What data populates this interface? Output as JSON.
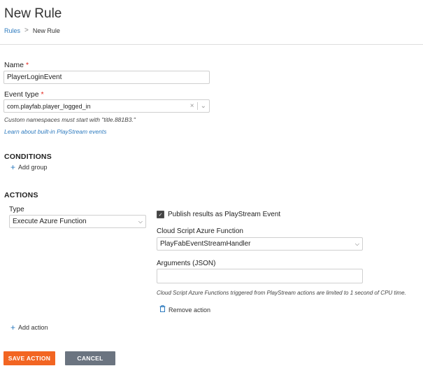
{
  "header": {
    "title": "New Rule",
    "breadcrumb": {
      "parent": "Rules",
      "separator": ">",
      "current": "New Rule"
    }
  },
  "form": {
    "name_label": "Name",
    "name_value": "PlayerLoginEvent",
    "required_mark": "*",
    "event_type_label": "Event type",
    "event_type_value": "com.playfab.player_logged_in",
    "clear_glyph": "×",
    "chevron_glyph": "⌄",
    "namespace_hint": "Custom namespaces must start with \"title.881B3.\"",
    "learn_link": "Learn about built-in PlayStream events"
  },
  "conditions": {
    "heading": "CONDITIONS",
    "add_group": "Add group"
  },
  "actions": {
    "heading": "ACTIONS",
    "type_label": "Type",
    "type_value": "Execute Azure Function",
    "publish_label": "Publish results as PlayStream Event",
    "publish_checked": true,
    "cs_function_label": "Cloud Script Azure Function",
    "cs_function_value": "PlayFabEventStreamHandler",
    "args_label": "Arguments (JSON)",
    "args_value": "",
    "cpu_note": "Cloud Script Azure Functions triggered from PlayStream actions are limited to 1 second of CPU time.",
    "remove_action": "Remove action",
    "add_action": "Add action"
  },
  "buttons": {
    "save": "SAVE ACTION",
    "cancel": "CANCEL"
  },
  "colors": {
    "primary_orange": "#f26522",
    "secondary_gray": "#6b7480",
    "link_blue": "#2e7bbf",
    "required_red": "#e2231a"
  },
  "icons": {
    "plus": "+",
    "trash": "🗑",
    "check": "✓"
  }
}
